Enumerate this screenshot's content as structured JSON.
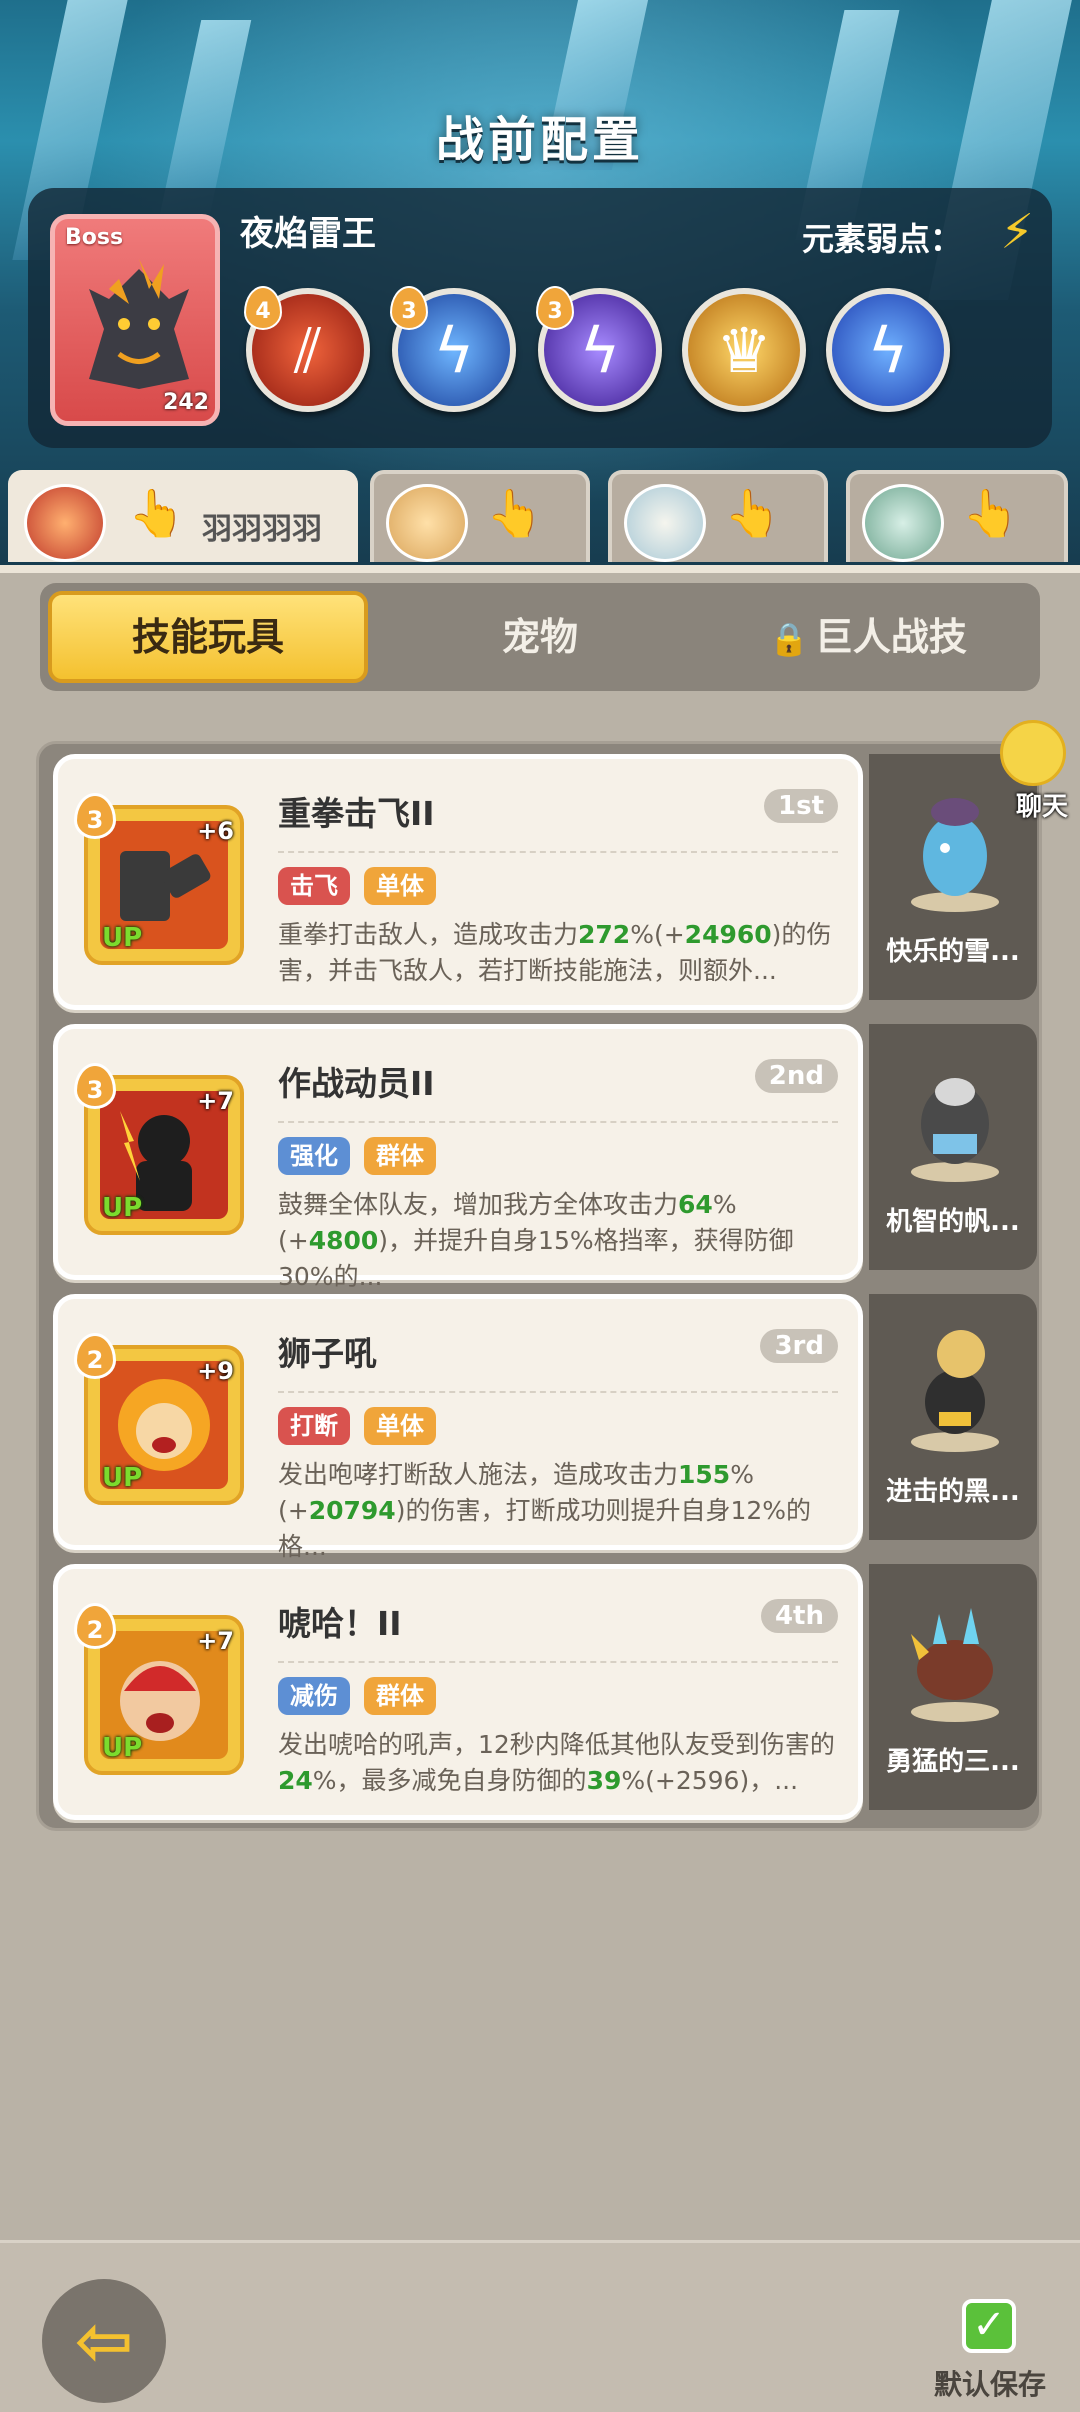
{
  "header": {
    "title": "战前配置"
  },
  "boss": {
    "tag": "Boss",
    "level": "242",
    "name": "夜焰雷王",
    "weakness_label": "元素弱点：",
    "weakness_icon": "lightning-icon",
    "skills": [
      {
        "level": "4",
        "icon": "claw-slash-icon",
        "color": "#c8321e"
      },
      {
        "level": "3",
        "icon": "lightning-bolt-icon",
        "color": "#2f6fd1"
      },
      {
        "level": "3",
        "icon": "purple-lightning-icon",
        "color": "#6a3fc9"
      },
      {
        "level": "",
        "icon": "golden-crown-icon",
        "color": "#e0a12b"
      },
      {
        "level": "",
        "icon": "blue-lightning-icon",
        "color": "#2a6ee0"
      }
    ]
  },
  "team_tabs": [
    {
      "name": "羽羽羽羽",
      "active": true
    },
    {
      "name": "",
      "active": false
    },
    {
      "name": "",
      "active": false
    },
    {
      "name": "",
      "active": false
    }
  ],
  "segment": {
    "tabs": [
      "技能玩具",
      "宠物",
      "巨人战技"
    ],
    "active_index": 0
  },
  "skills": [
    {
      "level": "3",
      "plus": "+6",
      "up": "UP",
      "name": "重拳击飞II",
      "rank": "1st",
      "tags": [
        {
          "label": "击飞",
          "color": "red"
        },
        {
          "label": "单体",
          "color": "orange"
        }
      ],
      "desc_parts": [
        "重拳打击敌人，造成攻击力",
        "272",
        "%(+",
        "24960",
        ")的伤害，并击飞敌人，若打断技能施法，则额外..."
      ],
      "pet": "快乐的雪..."
    },
    {
      "level": "3",
      "plus": "+7",
      "up": "UP",
      "name": "作战动员II",
      "rank": "2nd",
      "tags": [
        {
          "label": "强化",
          "color": "blue"
        },
        {
          "label": "群体",
          "color": "orange"
        }
      ],
      "desc_parts": [
        "鼓舞全体队友，增加我方全体攻击力",
        "64",
        "%(+",
        "4800",
        ")，并提升自身15%格挡率，获得防御30%的..."
      ],
      "pet": "机智的帆..."
    },
    {
      "level": "2",
      "plus": "+9",
      "up": "UP",
      "name": "狮子吼",
      "rank": "3rd",
      "tags": [
        {
          "label": "打断",
          "color": "red"
        },
        {
          "label": "单体",
          "color": "orange"
        }
      ],
      "desc_parts": [
        "发出咆哮打断敌人施法，造成攻击力",
        "155",
        "%(+",
        "20794",
        ")的伤害，打断成功则提升自身12%的格..."
      ],
      "pet": "进击的黑..."
    },
    {
      "level": "2",
      "plus": "+7",
      "up": "UP",
      "name": "唬哈！II",
      "rank": "4th",
      "tags": [
        {
          "label": "减伤",
          "color": "blue"
        },
        {
          "label": "群体",
          "color": "orange"
        }
      ],
      "desc_parts": [
        "发出唬哈的吼声，12秒内降低其他队友受到伤害的",
        "24",
        "%，最多减免自身防御的",
        "39",
        "%(+2596)，..."
      ],
      "pet": "勇猛的三..."
    }
  ],
  "chat": {
    "label": "聊天"
  },
  "footer": {
    "back_icon": "back-arrow-icon",
    "save_label": "默认保存"
  }
}
